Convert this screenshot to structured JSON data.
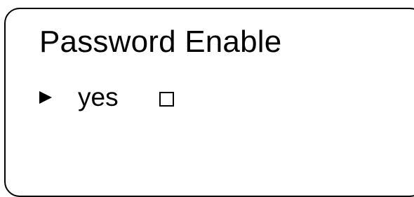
{
  "menu": {
    "title": "Password Enable",
    "options": [
      {
        "label": "yes",
        "selected": true,
        "checked": false,
        "pointer_icon": "triangle-right-icon",
        "checkbox_icon": "empty-checkbox-icon"
      }
    ]
  },
  "colors": {
    "foreground": "#000000",
    "background": "#ffffff"
  }
}
